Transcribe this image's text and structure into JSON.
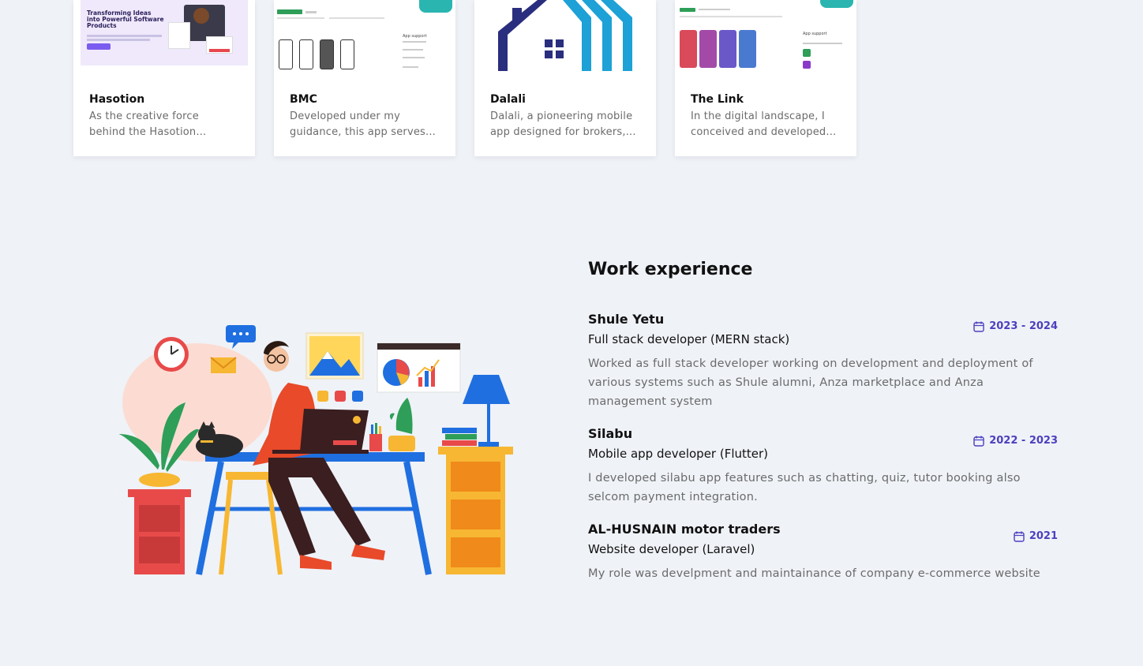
{
  "projects": [
    {
      "title": "Hasotion",
      "desc_line1": "As the creative force",
      "desc_line2": "behind the Hasotion...",
      "thumb_heading": "Transforming Ideas into Powerful Software Products",
      "icon": "hasotion-thumbnail"
    },
    {
      "title": "BMC",
      "desc_line1": "Developed under my",
      "desc_line2": "guidance, this app serves...",
      "thumb_heading": "App support",
      "icon": "bmc-thumbnail"
    },
    {
      "title": "Dalali",
      "desc_line1": "Dalali, a pioneering mobile",
      "desc_line2": "app designed for brokers,...",
      "icon": "dalali-logo"
    },
    {
      "title": "The Link",
      "desc_line1": "In the digital landscape, I",
      "desc_line2": "conceived and developed...",
      "thumb_heading": "App support",
      "icon": "thelink-thumbnail"
    }
  ],
  "work": {
    "title": "Work experience",
    "jobs": [
      {
        "company": "Shule Yetu",
        "role": "Full stack developer (MERN stack)",
        "period": "2023 - 2024",
        "desc": "Worked as full stack developer working on development and deployment of various systems such as Shule alumni, Anza marketplace and Anza management system"
      },
      {
        "company": "Silabu",
        "role": "Mobile app developer (Flutter)",
        "period": "2022 - 2023",
        "desc": "I developed silabu app features such as chatting, quiz, tutor booking also selcom payment integration."
      },
      {
        "company": "AL-HUSNAIN motor traders",
        "role": "Website developer (Laravel)",
        "period": "2021",
        "desc": "My role was develpment and maintainance of company e-commerce website"
      }
    ]
  },
  "colors": {
    "accent": "#4b3fbf",
    "background": "#eff2f7",
    "muted_text": "#6b6b6b"
  }
}
